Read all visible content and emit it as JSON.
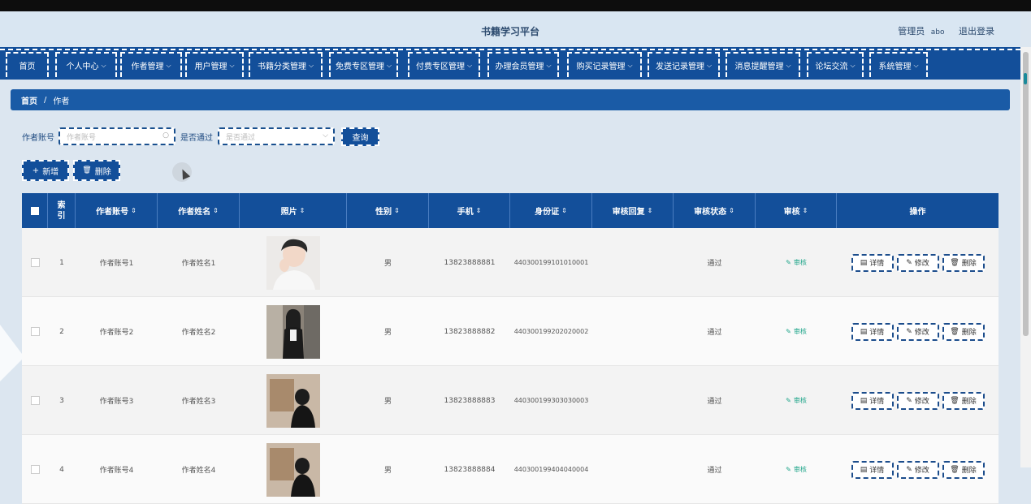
{
  "header": {
    "title": "书籍学习平台",
    "user_role": "管理员",
    "username": "abo",
    "logout": "退出登录"
  },
  "nav": {
    "items": [
      {
        "label": "首页",
        "has_dropdown": false
      },
      {
        "label": "个人中心",
        "has_dropdown": true
      },
      {
        "label": "作者管理",
        "has_dropdown": true
      },
      {
        "label": "用户管理",
        "has_dropdown": true
      },
      {
        "label": "书籍分类管理",
        "has_dropdown": true
      },
      {
        "label": "免费专区管理",
        "has_dropdown": true
      },
      {
        "label": "付费专区管理",
        "has_dropdown": true
      },
      {
        "label": "办理会员管理",
        "has_dropdown": true
      },
      {
        "label": "购买记录管理",
        "has_dropdown": true
      },
      {
        "label": "发送记录管理",
        "has_dropdown": true
      },
      {
        "label": "消息提醒管理",
        "has_dropdown": true
      },
      {
        "label": "论坛交流",
        "has_dropdown": true
      },
      {
        "label": "系统管理",
        "has_dropdown": true
      }
    ]
  },
  "breadcrumb": {
    "home": "首页",
    "separator": "/",
    "current": "作者"
  },
  "search": {
    "account_label": "作者账号",
    "account_placeholder": "作者账号",
    "approved_label": "是否通过",
    "approved_placeholder": "是否通过",
    "query_button": "查询"
  },
  "actions": {
    "add": "新增",
    "delete": "删除"
  },
  "table": {
    "columns": [
      "索引",
      "作者账号",
      "作者姓名",
      "照片",
      "性别",
      "手机",
      "身份证",
      "审核回复",
      "审核状态",
      "审核",
      "操作"
    ],
    "rows": [
      {
        "index": "1",
        "account": "作者账号1",
        "name": "作者姓名1",
        "gender": "男",
        "phone": "13823888881",
        "id_card": "440300199101010001",
        "reply": "",
        "status": "通过",
        "audit": "审核"
      },
      {
        "index": "2",
        "account": "作者账号2",
        "name": "作者姓名2",
        "gender": "男",
        "phone": "13823888882",
        "id_card": "440300199202020002",
        "reply": "",
        "status": "通过",
        "audit": "审核"
      },
      {
        "index": "3",
        "account": "作者账号3",
        "name": "作者姓名3",
        "gender": "男",
        "phone": "13823888883",
        "id_card": "440300199303030003",
        "reply": "",
        "status": "通过",
        "audit": "审核"
      },
      {
        "index": "4",
        "account": "作者账号4",
        "name": "作者姓名4",
        "gender": "男",
        "phone": "13823888884",
        "id_card": "440300199404040004",
        "reply": "",
        "status": "通过",
        "audit": "审核"
      }
    ],
    "row_actions": {
      "detail": "详情",
      "edit": "修改",
      "delete": "删除"
    }
  },
  "colors": {
    "primary": "#134f9a",
    "header_bg": "#d9e6f2",
    "page_bg": "#dce6f0",
    "audit_link": "#1fa58a"
  },
  "icons": {
    "search": "search-icon",
    "chevron": "chevron-down-icon",
    "sort": "sort-icon",
    "add": "plus-icon",
    "delete": "trash-icon",
    "detail": "document-icon",
    "edit": "pencil-icon"
  }
}
